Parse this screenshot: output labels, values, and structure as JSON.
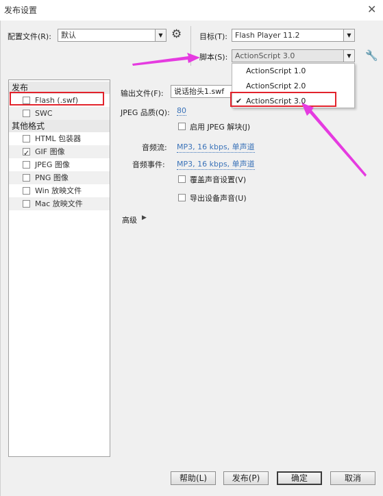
{
  "window": {
    "title": "发布设置",
    "close_glyph": "✕"
  },
  "profile": {
    "label": "配置文件(R):",
    "value": "默认"
  },
  "target": {
    "label": "目标(T):",
    "value": "Flash Player 11.2"
  },
  "script": {
    "label": "脚本(S):",
    "value": "ActionScript 3.0",
    "options": [
      "ActionScript 1.0",
      "ActionScript 2.0",
      "ActionScript 3.0"
    ],
    "selected_index": 2
  },
  "sidebar": {
    "publish_header": "发布",
    "publish_items": [
      {
        "label": "Flash (.swf)",
        "checked": false
      },
      {
        "label": "SWC",
        "checked": false
      }
    ],
    "other_header": "其他格式",
    "other_items": [
      {
        "label": "HTML 包装器",
        "checked": false
      },
      {
        "label": "GIF 图像",
        "checked": true
      },
      {
        "label": "JPEG 图像",
        "checked": false
      },
      {
        "label": "PNG 图像",
        "checked": false
      },
      {
        "label": "Win 放映文件",
        "checked": false
      },
      {
        "label": "Mac 放映文件",
        "checked": false
      }
    ]
  },
  "settings": {
    "output_label": "输出文件(F):",
    "output_value": "说话抬头1.swf",
    "jpeg_label": "JPEG 品质(Q):",
    "jpeg_value": "80",
    "enable_jpeg_label": "启用 JPEG 解块(J)",
    "audio_stream_label": "音频流:",
    "audio_stream_value": "MP3, 16 kbps, 单声道",
    "audio_event_label": "音频事件:",
    "audio_event_value": "MP3, 16 kbps, 单声道",
    "override_sound_label": "覆盖声音设置(V)",
    "export_sound_label": "导出设备声音(U)",
    "advanced_label": "高级"
  },
  "buttons": {
    "help": "帮助(L)",
    "publish": "发布(P)",
    "ok": "确定",
    "cancel": "取消"
  },
  "colors": {
    "highlight": "#e2222b",
    "arrow": "#e53be0",
    "link": "#3b73b9"
  },
  "icons": [
    "gear-icon",
    "wrench-icon",
    "dropdown-arrow-icon",
    "check-icon",
    "play-triangle-icon",
    "close-icon"
  ]
}
